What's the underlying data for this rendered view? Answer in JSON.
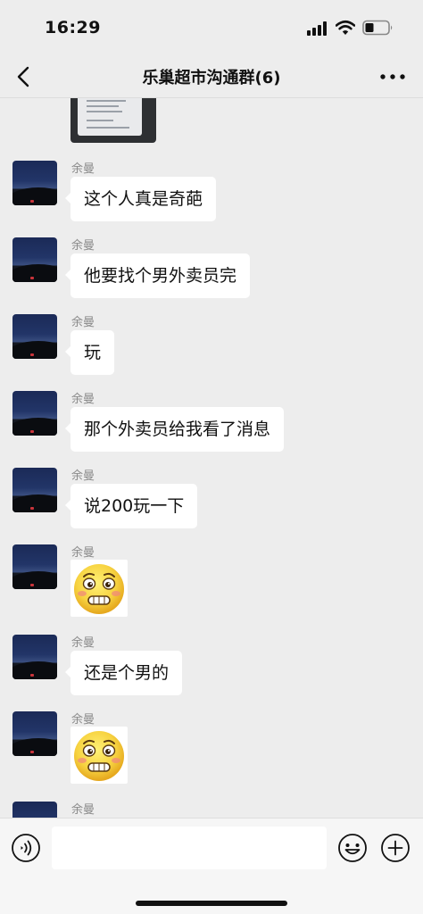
{
  "status_bar": {
    "time": "16:29",
    "icons": [
      "signal-icon",
      "wifi-icon",
      "battery-icon"
    ]
  },
  "nav": {
    "title": "乐巢超市沟通群(6)",
    "back_icon": "chevron-left-icon",
    "more_icon": "more-icon"
  },
  "messages": [
    {
      "sender": "余曼",
      "type": "text",
      "text": "这个人真是奇葩"
    },
    {
      "sender": "余曼",
      "type": "text",
      "text": "他要找个男外卖员完"
    },
    {
      "sender": "余曼",
      "type": "text",
      "text": "玩"
    },
    {
      "sender": "余曼",
      "type": "text",
      "text": "那个外卖员给我看了消息"
    },
    {
      "sender": "余曼",
      "type": "text",
      "text": "说200玩一下"
    },
    {
      "sender": "余曼",
      "type": "sticker",
      "sticker": "embarrassed-face-sticker"
    },
    {
      "sender": "余曼",
      "type": "text",
      "text": "还是个男的"
    },
    {
      "sender": "余曼",
      "type": "sticker",
      "sticker": "embarrassed-face-sticker"
    },
    {
      "sender": "余曼",
      "type": "partial"
    }
  ],
  "input_bar": {
    "value": "",
    "placeholder": "",
    "icons": [
      "voice-icon",
      "emoji-icon",
      "plus-icon"
    ]
  },
  "colors": {
    "background": "#ededed",
    "bubble": "#ffffff",
    "sender_name": "#8a8a8a",
    "sticker_face": "#f7d341"
  }
}
